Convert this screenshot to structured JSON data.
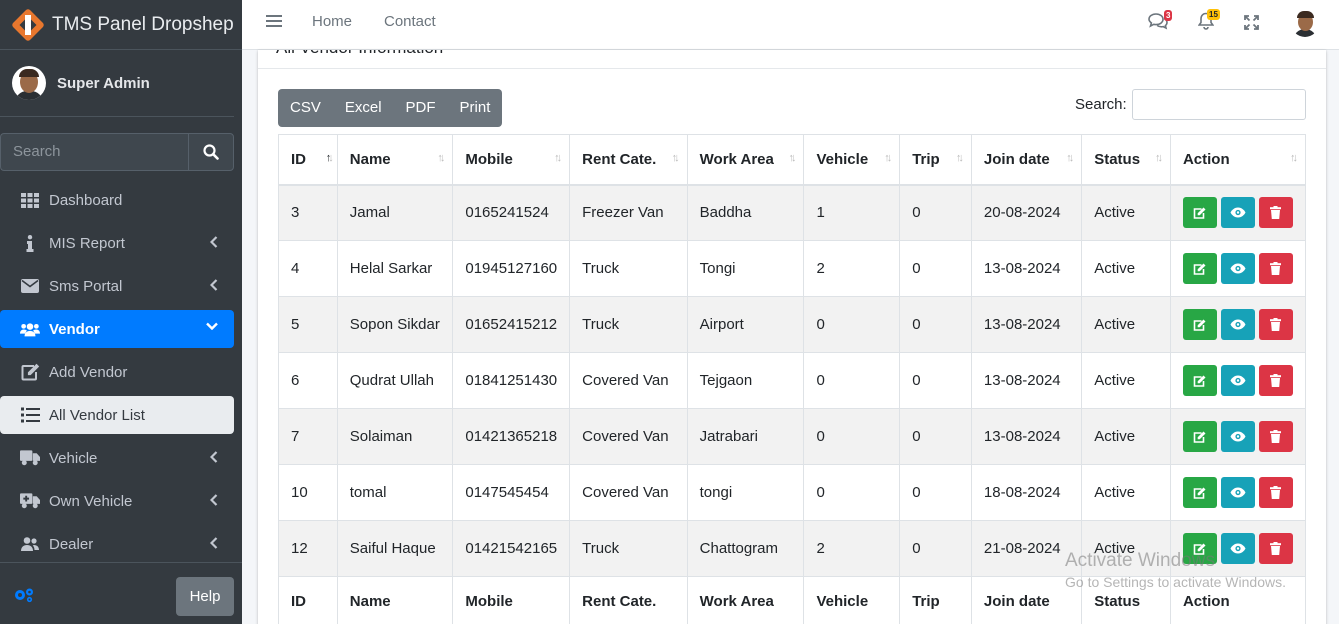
{
  "brand": {
    "name_light": "TMS Panel",
    "name_bold": "Dropshep"
  },
  "user": {
    "name": "Super Admin"
  },
  "sidebar_search": {
    "placeholder": "Search"
  },
  "sidebar": {
    "items": [
      {
        "label": "Dashboard",
        "icon": "grid-icon"
      },
      {
        "label": "MIS Report",
        "icon": "info-icon"
      },
      {
        "label": "Sms Portal",
        "icon": "envelope-icon"
      },
      {
        "label": "Vendor",
        "icon": "users-icon"
      },
      {
        "label": "Add Vendor",
        "icon": "edit-icon"
      },
      {
        "label": "All Vendor List",
        "icon": "list-icon"
      },
      {
        "label": "Vehicle",
        "icon": "truck-icon"
      },
      {
        "label": "Own Vehicle",
        "icon": "truck-medical-icon"
      },
      {
        "label": "Dealer",
        "icon": "user-group-icon"
      }
    ],
    "help_label": "Help"
  },
  "topnav": {
    "links": [
      "Home",
      "Contact"
    ],
    "messages_count": "3",
    "notifications_count": "15"
  },
  "card": {
    "title": "All Vendor Information"
  },
  "export_buttons": [
    "CSV",
    "Excel",
    "PDF",
    "Print"
  ],
  "table_search_label": "Search:",
  "table": {
    "columns": [
      "ID",
      "Name",
      "Mobile",
      "Rent Cate.",
      "Work Area",
      "Vehicle",
      "Trip",
      "Join date",
      "Status",
      "Action"
    ],
    "rows": [
      [
        "3",
        "Jamal",
        "0165241524",
        "Freezer Van",
        "Baddha",
        "1",
        "0",
        "20-08-2024",
        "Active"
      ],
      [
        "4",
        "Helal Sarkar",
        "01945127160",
        "Truck",
        "Tongi",
        "2",
        "0",
        "13-08-2024",
        "Active"
      ],
      [
        "5",
        "Sopon Sikdar",
        "01652415212",
        "Truck",
        "Airport",
        "0",
        "0",
        "13-08-2024",
        "Active"
      ],
      [
        "6",
        "Qudrat Ullah",
        "01841251430",
        "Covered Van",
        "Tejgaon",
        "0",
        "0",
        "13-08-2024",
        "Active"
      ],
      [
        "7",
        "Solaiman",
        "01421365218",
        "Covered Van",
        "Jatrabari",
        "0",
        "0",
        "13-08-2024",
        "Active"
      ],
      [
        "10",
        "tomal",
        "0147545454",
        "Covered Van",
        "tongi",
        "0",
        "0",
        "18-08-2024",
        "Active"
      ],
      [
        "12",
        "Saiful Haque",
        "01421542165",
        "Truck",
        "Chattogram",
        "2",
        "0",
        "21-08-2024",
        "Active"
      ]
    ]
  },
  "watermark": {
    "line1": "Activate Windows",
    "line2": "Go to Settings to activate Windows."
  },
  "colors": {
    "sidebar": "#343a40",
    "primary": "#007bff",
    "success": "#28a745",
    "info": "#17a2b8",
    "danger": "#dc3545",
    "secondary": "#6c757d"
  }
}
